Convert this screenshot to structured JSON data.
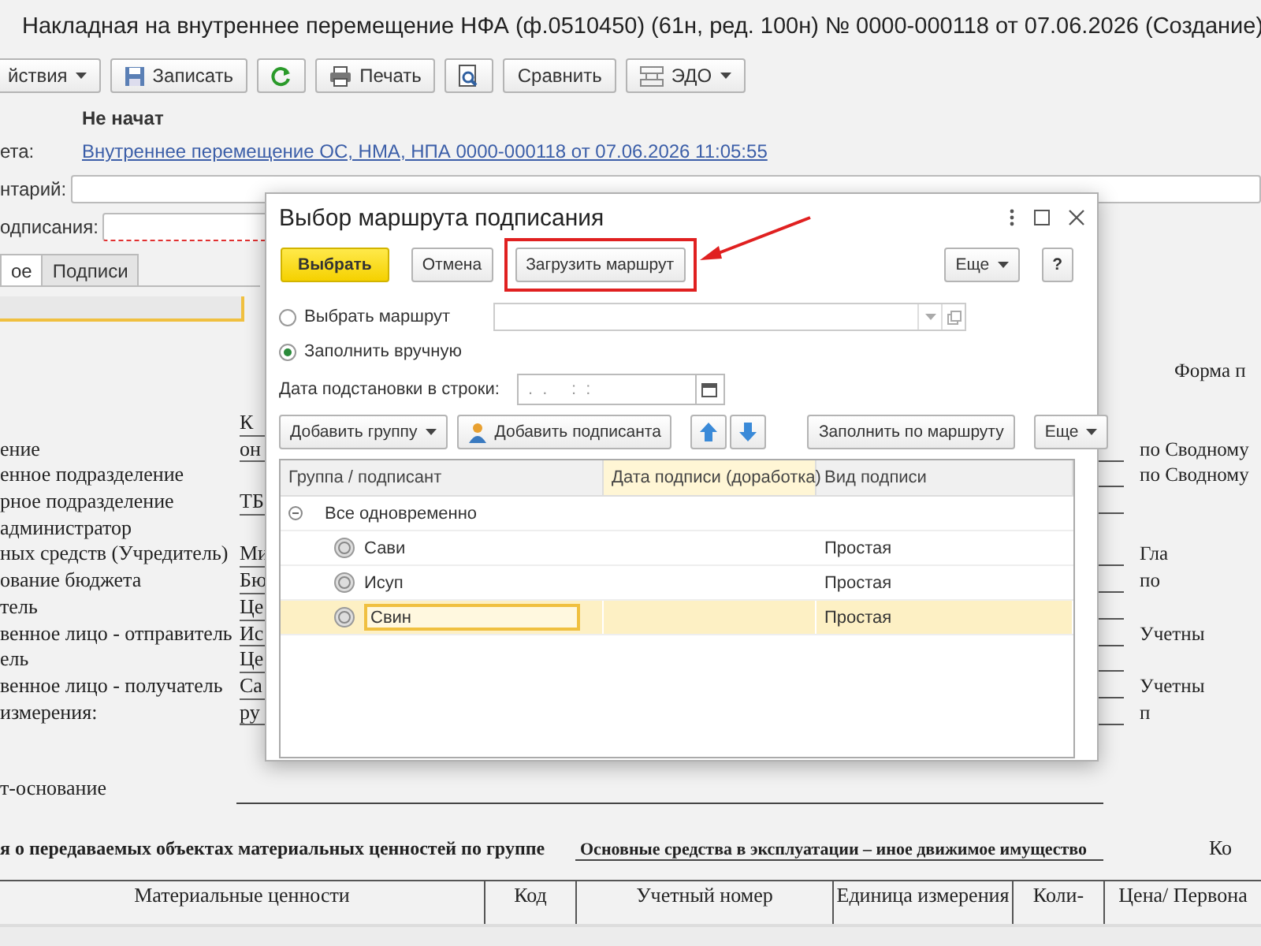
{
  "window": {
    "title": "Накладная на внутреннее перемещение НФА (ф.0510450) (61н, ред. 100н) № 0000-000118 от 07.06.2026 (Создание)"
  },
  "toolbar": [
    {
      "kind": "dropdown",
      "label": "йствия"
    },
    {
      "kind": "save",
      "label": "Записать"
    },
    {
      "kind": "refresh"
    },
    {
      "kind": "print",
      "label": "Печать"
    },
    {
      "kind": "preview"
    },
    {
      "kind": "plain",
      "label": "Сравнить"
    },
    {
      "kind": "edo",
      "label": "ЭДО"
    }
  ],
  "status": "Не начат",
  "basis": {
    "label": "ета:",
    "link": "Внутреннее перемещение ОС, НМА, НПА 0000-000118 от 07.06.2026 11:05:55"
  },
  "comment": {
    "label": "нтарий:"
  },
  "signing_route": {
    "label": "одписания:",
    "invalid": true
  },
  "tabs": [
    {
      "label": "ое",
      "selected": true
    },
    {
      "label": "Подписи",
      "selected": false
    }
  ],
  "print_form": {
    "form_label": "Форма п",
    "rows": [
      {
        "value": "К"
      },
      {
        "label": "ение",
        "value": "он",
        "right": "по Сводному"
      },
      {
        "label": "енное подразделение",
        "right": "по Сводному"
      },
      {
        "label": "рное подразделение",
        "value": "ТБ"
      },
      {
        "label": "администратор"
      },
      {
        "label": "ных средств (Учредитель)",
        "value": "Ми",
        "right": "Гла"
      },
      {
        "label": "ование бюджета",
        "value": "Бю",
        "right": "по"
      },
      {
        "label": "тель",
        "value": "Це"
      },
      {
        "label": "венное лицо - отправитель",
        "value": "Ис",
        "right": "Учетны"
      },
      {
        "label": "ель",
        "value": "Це"
      },
      {
        "label": "венное лицо - получатель",
        "value": "Са",
        "right": "Учетны"
      },
      {
        "label": "измерения:",
        "value": "ру",
        "right": "п"
      }
    ],
    "basis_label": "т-основание",
    "group_heading": "я о передаваемых объектах материальных ценностей по группе",
    "group_value": "Основные средства в эксплуатации – иное движимое имущество",
    "code_label": "Ко",
    "table_columns": [
      "Материальные ценности",
      "Код",
      "Учетный номер",
      "Единица измерения",
      "Коли-",
      "Цена/ Первона"
    ]
  },
  "dialog": {
    "title": "Выбор маршрута подписания",
    "buttons": [
      {
        "kind": "default",
        "label": "Выбрать",
        "highlighted": false
      },
      {
        "kind": "plain",
        "label": "Отмена",
        "highlighted": false
      },
      {
        "kind": "plain",
        "label": "Загрузить маршрут",
        "highlighted": true
      },
      {
        "kind": "dropdown",
        "label": "Еще",
        "highlighted": false
      },
      {
        "kind": "help",
        "label": "?",
        "highlighted": false
      }
    ],
    "options": [
      {
        "label": "Выбрать маршрут",
        "selected": false
      },
      {
        "label": "Заполнить вручную",
        "selected": true
      }
    ],
    "date_field": {
      "label": "Дата подстановки в строки:",
      "placeholder": ".  .     :  :"
    },
    "table_toolbar": [
      {
        "kind": "dropdown",
        "label": "Добавить группу"
      },
      {
        "kind": "person",
        "label": "Добавить подписанта"
      },
      {
        "kind": "up"
      },
      {
        "kind": "down"
      },
      {
        "kind": "plain",
        "label": "Заполнить по маршруту"
      },
      {
        "kind": "dropdown",
        "label": "Еще"
      }
    ],
    "table": {
      "columns": [
        {
          "label": "Группа / подписант",
          "selected": false
        },
        {
          "label": "Дата подписи (доработка)",
          "selected": true
        },
        {
          "label": "Вид подписи",
          "selected": false
        }
      ],
      "rows": [
        {
          "name": "Все одновременно",
          "expanded": true,
          "selected": false,
          "children": [
            {
              "name": "Сави",
              "type": "Простая",
              "selected": false
            },
            {
              "name": "Исуп",
              "type": "Простая",
              "selected": false
            },
            {
              "name": "Свин",
              "type": "Простая",
              "selected": true
            }
          ]
        }
      ]
    }
  }
}
